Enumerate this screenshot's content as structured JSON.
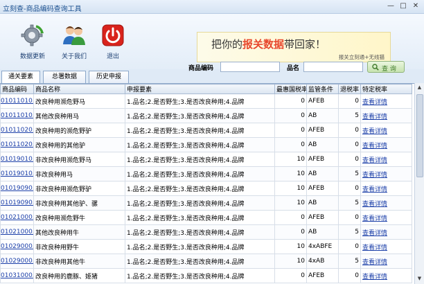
{
  "window": {
    "title": "立刻查-商品编码查询工具",
    "minimize": "—",
    "restore": "□",
    "close": "✕"
  },
  "toolbar": {
    "update_label": "数据更新",
    "about_label": "关于我们",
    "exit_label": "退出"
  },
  "banner": {
    "text_before": "把你的",
    "text_highlight": "报关数据",
    "text_after": "带回家！",
    "sub": "报关立刻通+无线猫"
  },
  "search": {
    "code_label": "商品编码",
    "code_value": "",
    "name_label": "品名",
    "name_value": "",
    "button_label": "查 询"
  },
  "tabs": [
    {
      "label": "通关要素"
    },
    {
      "label": "总署数据"
    },
    {
      "label": "历史申报"
    }
  ],
  "table": {
    "columns": [
      "商品编码",
      "商品名称",
      "申报要素",
      "最惠国税率",
      "监管条件",
      "退税率",
      "特定税率"
    ],
    "rows": [
      {
        "code": "01011010.10",
        "name": "改良种用濒危野马",
        "elements": "1.品名;2.是否野生;3.是否改良种用;4.品牌",
        "mfn": "0",
        "reg": "AFEB",
        "rebate": "0",
        "special": "查看详情"
      },
      {
        "code": "01011010.90",
        "name": "其他改良种用马",
        "elements": "1.品名;2.是否野生;3.是否改良种用;4.品牌",
        "mfn": "0",
        "reg": "AB",
        "rebate": "5",
        "special": "查看详情"
      },
      {
        "code": "01011020.10",
        "name": "改良种用的濒危野驴",
        "elements": "1.品名;2.是否野生;3.是否改良种用;4.品牌",
        "mfn": "0",
        "reg": "AFEB",
        "rebate": "0",
        "special": "查看详情"
      },
      {
        "code": "01011020.90",
        "name": "改良种用的其他驴",
        "elements": "1.品名;2.是否野生;3.是否改良种用;4.品牌",
        "mfn": "0",
        "reg": "AB",
        "rebate": "0",
        "special": "查看详情"
      },
      {
        "code": "01019010.10",
        "name": "非改良种用濒危野马",
        "elements": "1.品名;2.是否野生;3.是否改良种用;4.品牌",
        "mfn": "10",
        "reg": "AFEB",
        "rebate": "0",
        "special": "查看详情"
      },
      {
        "code": "01019010.90",
        "name": "非改良种用马",
        "elements": "1.品名;2.是否野生;3.是否改良种用;4.品牌",
        "mfn": "10",
        "reg": "AB",
        "rebate": "5",
        "special": "查看详情"
      },
      {
        "code": "01019090.10",
        "name": "非改良种用濒危野驴",
        "elements": "1.品名;2.是否野生;3.是否改良种用;4.品牌",
        "mfn": "10",
        "reg": "AFEB",
        "rebate": "0",
        "special": "查看详情"
      },
      {
        "code": "01019090.90",
        "name": "非改良种用其他驴、骡",
        "elements": "1.品名;2.是否野生;3.是否改良种用;4.品牌",
        "mfn": "10",
        "reg": "AB",
        "rebate": "5",
        "special": "查看详情"
      },
      {
        "code": "01021000.10",
        "name": "改良种用濒危野牛",
        "elements": "1.品名;2.是否野生;3.是否改良种用;4.品牌",
        "mfn": "0",
        "reg": "AFEB",
        "rebate": "0",
        "special": "查看详情"
      },
      {
        "code": "01021000.90",
        "name": "其他改良种用牛",
        "elements": "1.品名;2.是否野生;3.是否改良种用;4.品牌",
        "mfn": "0",
        "reg": "AB",
        "rebate": "5",
        "special": "查看详情"
      },
      {
        "code": "01029000.10",
        "name": "非改良种用野牛",
        "elements": "1.品名;2.是否野生;3.是否改良种用;4.品牌",
        "mfn": "10",
        "reg": "4xABFE",
        "rebate": "0",
        "special": "查看详情"
      },
      {
        "code": "01029000.90",
        "name": "非改良种用其他牛",
        "elements": "1.品名;2.是否野生;3.是否改良种用;4.品牌",
        "mfn": "10",
        "reg": "4xAB",
        "rebate": "5",
        "special": "查看详情"
      },
      {
        "code": "01031000.10",
        "name": "改良种用的鹿豚、姬猪",
        "elements": "1.品名;2.是否野生;3.是否改良种用;4.品牌",
        "mfn": "0",
        "reg": "AFEB",
        "rebate": "0",
        "special": "查看详情"
      }
    ]
  },
  "colors": {
    "accent": "#1a3ea8",
    "banner_highlight": "#e8472c",
    "exit_red": "#d9231c"
  }
}
